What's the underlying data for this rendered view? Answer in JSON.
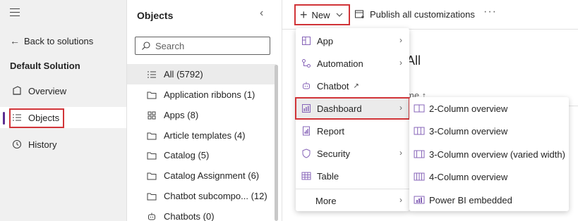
{
  "left_nav": {
    "back_label": "Back to solutions",
    "solution_title": "Default Solution",
    "items": [
      {
        "label": "Overview",
        "icon": "overview-icon"
      },
      {
        "label": "Objects",
        "icon": "list-icon"
      },
      {
        "label": "History",
        "icon": "history-icon"
      }
    ]
  },
  "objects_panel": {
    "title": "Objects",
    "search_placeholder": "Search",
    "rows": [
      {
        "label": "All",
        "count": "(5792)"
      },
      {
        "label": "Application ribbons",
        "count": "(1)"
      },
      {
        "label": "Apps",
        "count": "(8)"
      },
      {
        "label": "Article templates",
        "count": "(4)"
      },
      {
        "label": "Catalog",
        "count": "(5)"
      },
      {
        "label": "Catalog Assignment",
        "count": "(6)"
      },
      {
        "label": "Chatbot subcompo...",
        "count": "(12)"
      },
      {
        "label": "Chatbots",
        "count": "(0)"
      }
    ]
  },
  "command_bar": {
    "new_label": "New",
    "publish_label": "Publish all customizations",
    "more_label": "···"
  },
  "background": {
    "title_fragment": "All",
    "column_fragment": "me ↑"
  },
  "new_menu": {
    "items": [
      {
        "label": "App",
        "icon": "app-icon",
        "has_submenu": "true"
      },
      {
        "label": "Automation",
        "icon": "automation-icon",
        "has_submenu": "true"
      },
      {
        "label": "Chatbot",
        "icon": "chatbot-icon",
        "external": "↗"
      },
      {
        "label": "Dashboard",
        "icon": "dashboard-icon",
        "has_submenu": "true"
      },
      {
        "label": "Report",
        "icon": "report-icon"
      },
      {
        "label": "Security",
        "icon": "shield-icon",
        "has_submenu": "true"
      },
      {
        "label": "Table",
        "icon": "table-icon"
      },
      {
        "label": "More",
        "has_submenu": "true"
      }
    ]
  },
  "dashboard_submenu": {
    "items": [
      {
        "label": "2-Column overview",
        "icon": "two-column-icon"
      },
      {
        "label": "3-Column overview",
        "icon": "three-column-icon"
      },
      {
        "label": "3-Column overview (varied width)",
        "icon": "three-column-varied-icon"
      },
      {
        "label": "4-Column overview",
        "icon": "four-column-icon"
      },
      {
        "label": "Power BI embedded",
        "icon": "power-bi-icon"
      }
    ]
  },
  "colors": {
    "highlight": "#d13438",
    "accent": "#5c2e91",
    "icon_purple": "#8764b8"
  }
}
